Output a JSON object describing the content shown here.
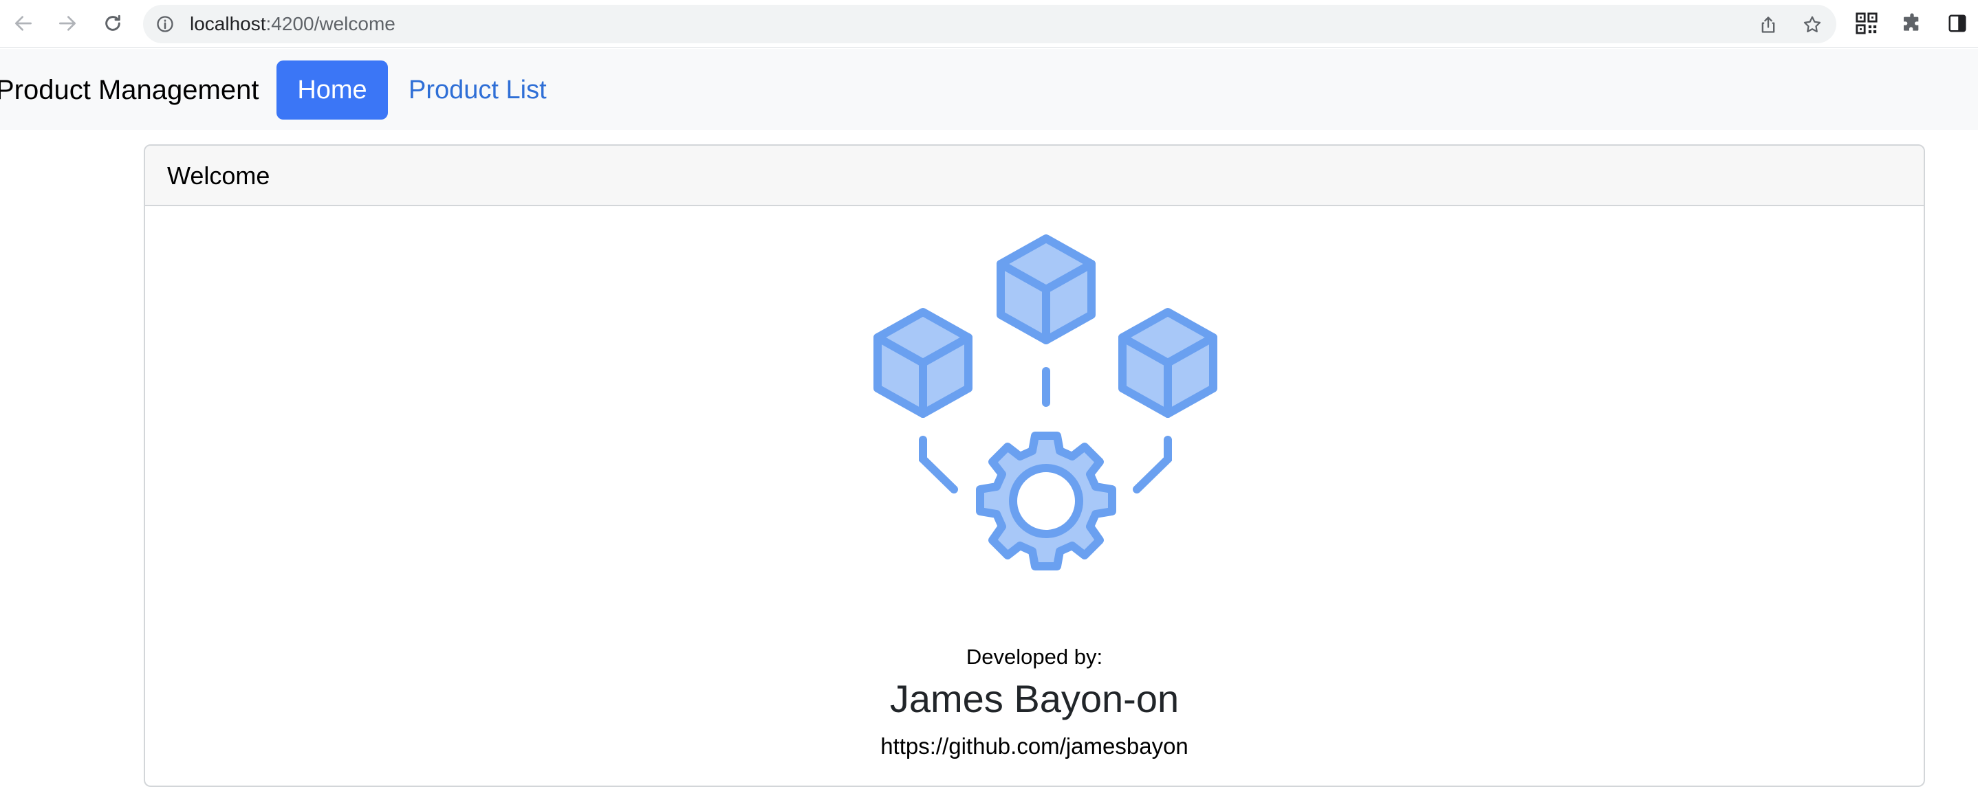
{
  "browser": {
    "url_host": "localhost",
    "url_path": ":4200/welcome",
    "icons": {
      "back": "arrow-left-icon",
      "forward": "arrow-right-icon",
      "reload": "reload-icon",
      "site_info": "info-icon",
      "share": "share-icon",
      "bookmark": "star-icon",
      "qr": "qr-code-icon",
      "extensions": "puzzle-icon",
      "side_panel": "side-panel-icon"
    }
  },
  "navbar": {
    "brand": "Product Management",
    "items": [
      {
        "label": "Home",
        "active": true
      },
      {
        "label": "Product List",
        "active": false
      }
    ]
  },
  "card": {
    "header": "Welcome",
    "illustration": "cubes-and-gear-icon",
    "developed_by_label": "Developed by:",
    "developer_name": "James Bayon-on",
    "developer_link": "https://github.com/jamesbayon"
  },
  "colors": {
    "primary": "#3b76f6",
    "link": "#2f6fd6",
    "illustration_stroke": "#6aa0f0",
    "illustration_fill": "#a8c8f8"
  }
}
